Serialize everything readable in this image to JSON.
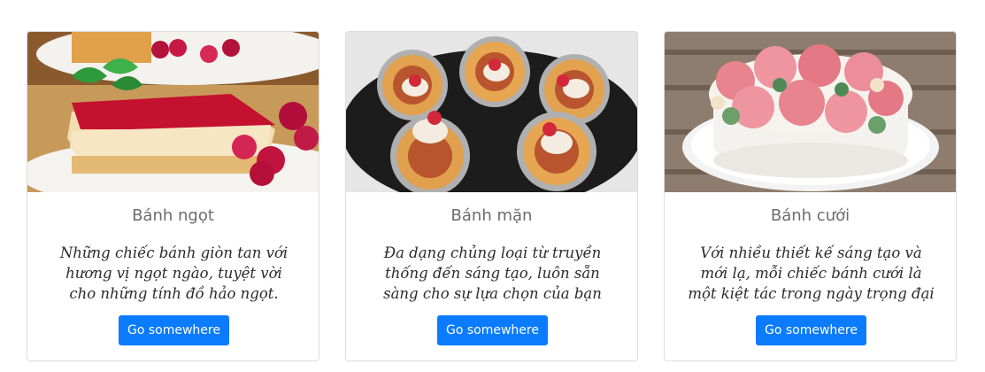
{
  "cards": [
    {
      "title": "Bánh ngọt",
      "text": "Những chiếc bánh giòn tan với hương vị ngọt ngào, tuyệt vời cho những tính đồ hảo ngọt.",
      "button": "Go somewhere",
      "image_icon": "cherry-cheesecake"
    },
    {
      "title": "Bánh mặn",
      "text": "Đa dạng chủng loại từ truyền thống đến sáng tạo, luôn sẵn sàng cho sự lựa chọn của bạn",
      "button": "Go somewhere",
      "image_icon": "savory-tarts"
    },
    {
      "title": "Bánh cưới",
      "text": "Với nhiều thiết kế sáng tạo và mới lạ, mỗi chiếc bánh cưới là một kiệt tác trong ngày trọng đại",
      "button": "Go somewhere",
      "image_icon": "floral-wedding-cake"
    }
  ],
  "colors": {
    "button": "#0b7bff",
    "title": "#6c6c6c",
    "border": "#dcdcdc"
  }
}
